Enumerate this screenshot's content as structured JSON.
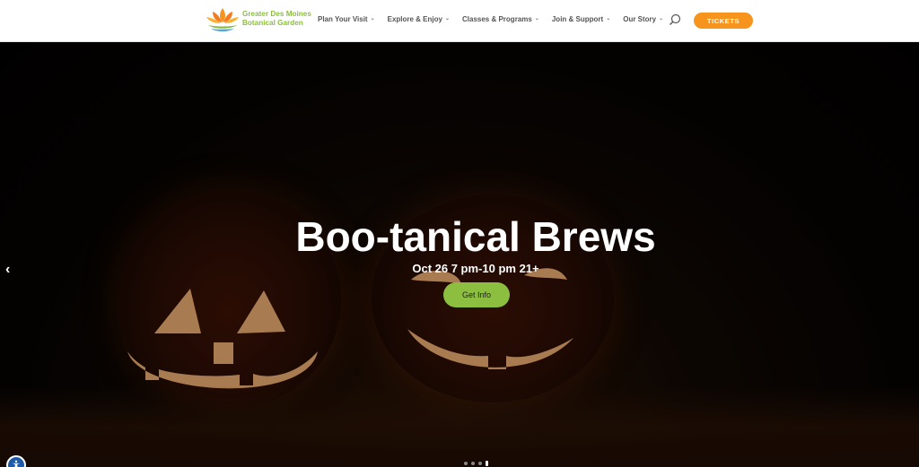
{
  "header": {
    "logo": {
      "line1": "Greater Des Moines",
      "line2": "Botanical Garden"
    },
    "nav": [
      {
        "label": "Plan Your Visit"
      },
      {
        "label": "Explore & Enjoy"
      },
      {
        "label": "Classes & Programs"
      },
      {
        "label": "Join & Support"
      },
      {
        "label": "Our Story"
      }
    ],
    "search_icon": "search-icon",
    "tickets_label": "TICKETS"
  },
  "hero": {
    "title": "Boo-tanical Brews",
    "subtitle": "Oct 26 7 pm-10 pm 21+",
    "cta_label": "Get Info",
    "prev_icon": "chevron-left-icon",
    "slide_count": 4,
    "active_slide": 4
  },
  "colors": {
    "accent_orange": "#f7941d",
    "accent_green": "#8cbf3f",
    "nav_text": "#555555"
  }
}
